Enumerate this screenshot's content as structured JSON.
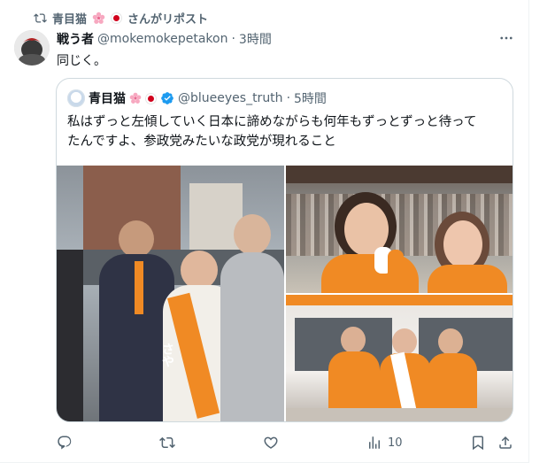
{
  "repost": {
    "text": "青目猫",
    "suffix": "さんがリポスト"
  },
  "post": {
    "author_name": "戦う者",
    "handle": "@mokemokepetakon",
    "separator": "·",
    "time": "3時間",
    "text": "同じく。"
  },
  "quote": {
    "author_name": "青目猫",
    "handle": "@blueeyes_truth",
    "separator": "·",
    "time": "5時間",
    "text_line1": "私はずっと左傾していく日本に諦めながらも何年もずっとずっと待って",
    "text_line2": "たんですよ、参政党みたいな政党が現れること"
  },
  "photo_text": {
    "sash": "さや"
  },
  "actions": {
    "views": "10"
  },
  "colors": {
    "accent": "#1d9bf0",
    "orange": "#f08a24",
    "muted": "#536471"
  }
}
